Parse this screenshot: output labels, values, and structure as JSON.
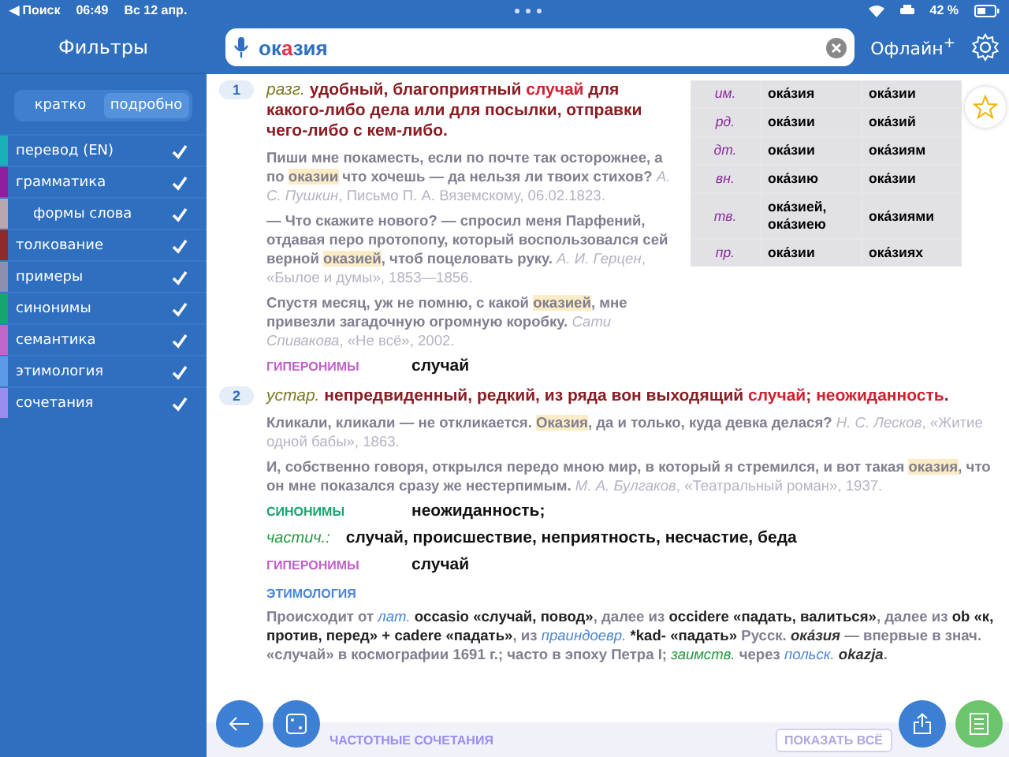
{
  "status_bar": {
    "back": "◀ Поиск",
    "time": "06:49",
    "date": "Вс 12 апр.",
    "battery": "42 %"
  },
  "sidebar": {
    "title": "Фильтры",
    "modes": [
      {
        "label": "кратко",
        "selected": false
      },
      {
        "label": "подробно",
        "selected": true
      }
    ],
    "items": [
      {
        "label": "перевод (EN)",
        "color": "#1ab0b8",
        "checked": true
      },
      {
        "label": "грамматика",
        "color": "#8e1fa0",
        "checked": true,
        "children": [
          {
            "label": "формы слова",
            "color": "#b9a6b0",
            "checked": true
          }
        ]
      },
      {
        "label": "толкование",
        "color": "#8e2a2a",
        "checked": true
      },
      {
        "label": "примеры",
        "color": "#8d8fae",
        "checked": true
      },
      {
        "label": "синонимы",
        "color": "#15a56e",
        "checked": true
      },
      {
        "label": "семантика",
        "color": "#c066c8",
        "checked": true
      },
      {
        "label": "этимология",
        "color": "#5a9ae8",
        "checked": true
      },
      {
        "label": "сочетания",
        "color": "#9a8cf0",
        "checked": true
      }
    ]
  },
  "search": {
    "value_parts": [
      {
        "text": "ок",
        "accent": false
      },
      {
        "text": "а",
        "accent": true
      },
      {
        "text": "зия",
        "accent": false
      }
    ]
  },
  "offline": "Офлайн$^{+}$",
  "cases": [
    {
      "case": "им.",
      "sg": "ока́зия",
      "pl": "ока́зии"
    },
    {
      "case": "рд.",
      "sg": "ока́зии",
      "pl": "ока́зий"
    },
    {
      "case": "дт.",
      "sg": "ока́зии",
      "pl": "ока́зиям"
    },
    {
      "case": "вн.",
      "sg": "ока́зию",
      "pl": "ока́зии"
    },
    {
      "case": "тв.",
      "sg": "ока́зией, ока́зиею",
      "pl": "ока́зиями"
    },
    {
      "case": "пр.",
      "sg": "ока́зии",
      "pl": "ока́зиях"
    }
  ],
  "senses": [
    {
      "number": "1",
      "label": "разг.",
      "definition": [
        {
          "kind": "def",
          "text": "удобный, благоприятный "
        },
        {
          "kind": "link",
          "text": "случай"
        },
        {
          "kind": "def",
          "text": " для какого-либо дела или для посылки, отправки чего-либо с кем-либо."
        }
      ],
      "examples": [
        [
          {
            "kind": "plain",
            "text": "Пиши мне покаместь, если по почте так осторожнее, а по "
          },
          {
            "kind": "hl",
            "text": "оказии"
          },
          {
            "kind": "plain",
            "text": " что хочешь — да нельзя ли твоих стихов? "
          },
          {
            "kind": "src",
            "text": "А. С. Пушкин"
          },
          {
            "kind": "srcplain",
            "text": ", Письмо П. А. Вяземскому, 06.02.1823."
          }
        ],
        [
          {
            "kind": "plain",
            "text": "— Что скажите нового? — спросил меня Парфений, отдавая перо протопопу, который воспользовался сей верной "
          },
          {
            "kind": "hl",
            "text": "оказией"
          },
          {
            "kind": "plain",
            "text": ", чтоб поцеловать руку. "
          },
          {
            "kind": "src",
            "text": "А. И. Герцен"
          },
          {
            "kind": "srcplain",
            "text": ", «Былое и думы», 1853—1856."
          }
        ],
        [
          {
            "kind": "plain",
            "text": "Спустя месяц, уж не помню, с какой "
          },
          {
            "kind": "hl",
            "text": "оказией"
          },
          {
            "kind": "plain",
            "text": ", мне привезли загадочную огромную коробку. "
          },
          {
            "kind": "src",
            "text": "Сати Спивакова"
          },
          {
            "kind": "srcplain",
            "text": ", «Не всё», 2002."
          }
        ]
      ],
      "relations": [
        {
          "kind": "hyper",
          "label": "ГИПЕРОНИМЫ",
          "value": "случай"
        }
      ]
    },
    {
      "number": "2",
      "label": "устар.",
      "definition": [
        {
          "kind": "def",
          "text": "непредвиденный, редкий, из ряда вон выходящий "
        },
        {
          "kind": "link",
          "text": "случай"
        },
        {
          "kind": "def",
          "text": "; "
        },
        {
          "kind": "link",
          "text": "неожиданность"
        },
        {
          "kind": "def",
          "text": "."
        }
      ],
      "examples": [
        [
          {
            "kind": "plain",
            "text": "Кликали, кликали — не откликается. "
          },
          {
            "kind": "hl",
            "text": "Оказия"
          },
          {
            "kind": "plain",
            "text": ", да и только, куда девка делася? "
          },
          {
            "kind": "src",
            "text": "Н. С. Лесков"
          },
          {
            "kind": "srcplain",
            "text": ", «Житие одной бабы», 1863."
          }
        ],
        [
          {
            "kind": "plain",
            "text": "И, собственно говоря, открылся передо мною мир, в который я стремился, и вот такая "
          },
          {
            "kind": "hl",
            "text": "оказия"
          },
          {
            "kind": "plain",
            "text": ", что он мне показался сразу же нестерпимым. "
          },
          {
            "kind": "src",
            "text": "М. А. Булгаков"
          },
          {
            "kind": "srcplain",
            "text": ", «Театральный роман», 1937."
          }
        ]
      ],
      "relations": [
        {
          "kind": "syn",
          "label": "СИНОНИМЫ",
          "value": "неожиданность;"
        },
        {
          "kind": "partial",
          "label": "частич.:",
          "value": "случай, происшествие, неприятность, несчастие, беда"
        },
        {
          "kind": "hyper",
          "label": "ГИПЕРОНИМЫ",
          "value": "случай"
        }
      ]
    }
  ],
  "etymology": {
    "title": "ЭТИМОЛОГИЯ",
    "text": [
      {
        "kind": "plain",
        "text": "Происходит от "
      },
      {
        "kind": "lang",
        "text": "лат."
      },
      {
        "kind": "bold",
        "text": " occasio «случай, повод»"
      },
      {
        "kind": "plain",
        "text": ", далее из "
      },
      {
        "kind": "bold",
        "text": "occidere «падать, валиться»"
      },
      {
        "kind": "plain",
        "text": ", далее из "
      },
      {
        "kind": "bold",
        "text": "ob «к, против, перед» + cadere «падать»"
      },
      {
        "kind": "plain",
        "text": ", из "
      },
      {
        "kind": "lang",
        "text": "праиндоевр."
      },
      {
        "kind": "bold",
        "text": " *kad- «падать»"
      },
      {
        "kind": "plain",
        "text": " Русск. "
      },
      {
        "kind": "ital",
        "text": "ока́зия"
      },
      {
        "kind": "plain",
        "text": " — впервые в знач. «случай» в космографии 1691 г.; часто в эпоху Петра I; "
      },
      {
        "kind": "green",
        "text": "заимств."
      },
      {
        "kind": "plain",
        "text": " через "
      },
      {
        "kind": "lang",
        "text": "польск."
      },
      {
        "kind": "ital",
        "text": " okazja"
      },
      {
        "kind": "plain",
        "text": "."
      }
    ]
  },
  "collocations": {
    "title": "ЧАСТОТНЫЕ СОЧЕТАНИЯ",
    "button": "ПОКАЗАТЬ ВСЁ"
  }
}
